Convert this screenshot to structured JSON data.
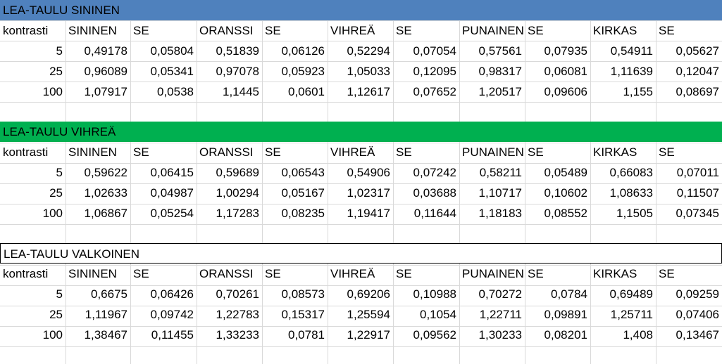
{
  "colors": {
    "blue": "#4f81bd",
    "green": "#00b050",
    "white_border": "#000000",
    "grid": "#d9d9d9"
  },
  "sections": [
    {
      "title": "LEA-TAULU SININEN",
      "band_color": "#4f81bd",
      "headers": [
        "kontrasti",
        "SININEN",
        "SE",
        "ORANSSI",
        "SE",
        "VIHREÄ",
        "SE",
        "PUNAINEN",
        "SE",
        "KIRKAS",
        "SE"
      ],
      "rows": [
        [
          "5",
          "0,49178",
          "0,05804",
          "0,51839",
          "0,06126",
          "0,52294",
          "0,07054",
          "0,57561",
          "0,07935",
          "0,54911",
          "0,05627"
        ],
        [
          "25",
          "0,96089",
          "0,05341",
          "0,97078",
          "0,05923",
          "1,05033",
          "0,12095",
          "0,98317",
          "0,06081",
          "1,11639",
          "0,12047"
        ],
        [
          "100",
          "1,07917",
          "0,0538",
          "1,1445",
          "0,0601",
          "1,12617",
          "0,07652",
          "1,20517",
          "0,09606",
          "1,155",
          "0,08697"
        ]
      ]
    },
    {
      "title": "LEA-TAULU VIHREÄ",
      "band_color": "#00b050",
      "headers": [
        "kontrasti",
        "SININEN",
        "SE",
        "ORANSSI",
        "SE",
        "VIHREÄ",
        "SE",
        "PUNAINEN",
        "SE",
        "KIRKAS",
        "SE"
      ],
      "rows": [
        [
          "5",
          "0,59622",
          "0,06415",
          "0,59689",
          "0,06543",
          "0,54906",
          "0,07242",
          "0,58211",
          "0,05489",
          "0,66083",
          "0,07011"
        ],
        [
          "25",
          "1,02633",
          "0,04987",
          "1,00294",
          "0,05167",
          "1,02317",
          "0,03688",
          "1,10717",
          "0,10602",
          "1,08633",
          "0,11507"
        ],
        [
          "100",
          "1,06867",
          "0,05254",
          "1,17283",
          "0,08235",
          "1,19417",
          "0,11644",
          "1,18183",
          "0,08552",
          "1,1505",
          "0,07345"
        ]
      ]
    },
    {
      "title": "LEA-TAULU VALKOINEN",
      "band_color": "#ffffff",
      "headers": [
        "kontrasti",
        "SININEN",
        "SE",
        "ORANSSI",
        "SE",
        "VIHREÄ",
        "SE",
        "PUNAINEN",
        "SE",
        "KIRKAS",
        "SE"
      ],
      "rows": [
        [
          "5",
          "0,6675",
          "0,06426",
          "0,70261",
          "0,08573",
          "0,69206",
          "0,10988",
          "0,70272",
          "0,0784",
          "0,69489",
          "0,09259"
        ],
        [
          "25",
          "1,11967",
          "0,09742",
          "1,22783",
          "0,15317",
          "1,25594",
          "0,1054",
          "1,22711",
          "0,09891",
          "1,25711",
          "0,07406"
        ],
        [
          "100",
          "1,38467",
          "0,11455",
          "1,33233",
          "0,0781",
          "1,22917",
          "0,09562",
          "1,30233",
          "0,08201",
          "1,408",
          "0,13467"
        ]
      ]
    }
  ]
}
